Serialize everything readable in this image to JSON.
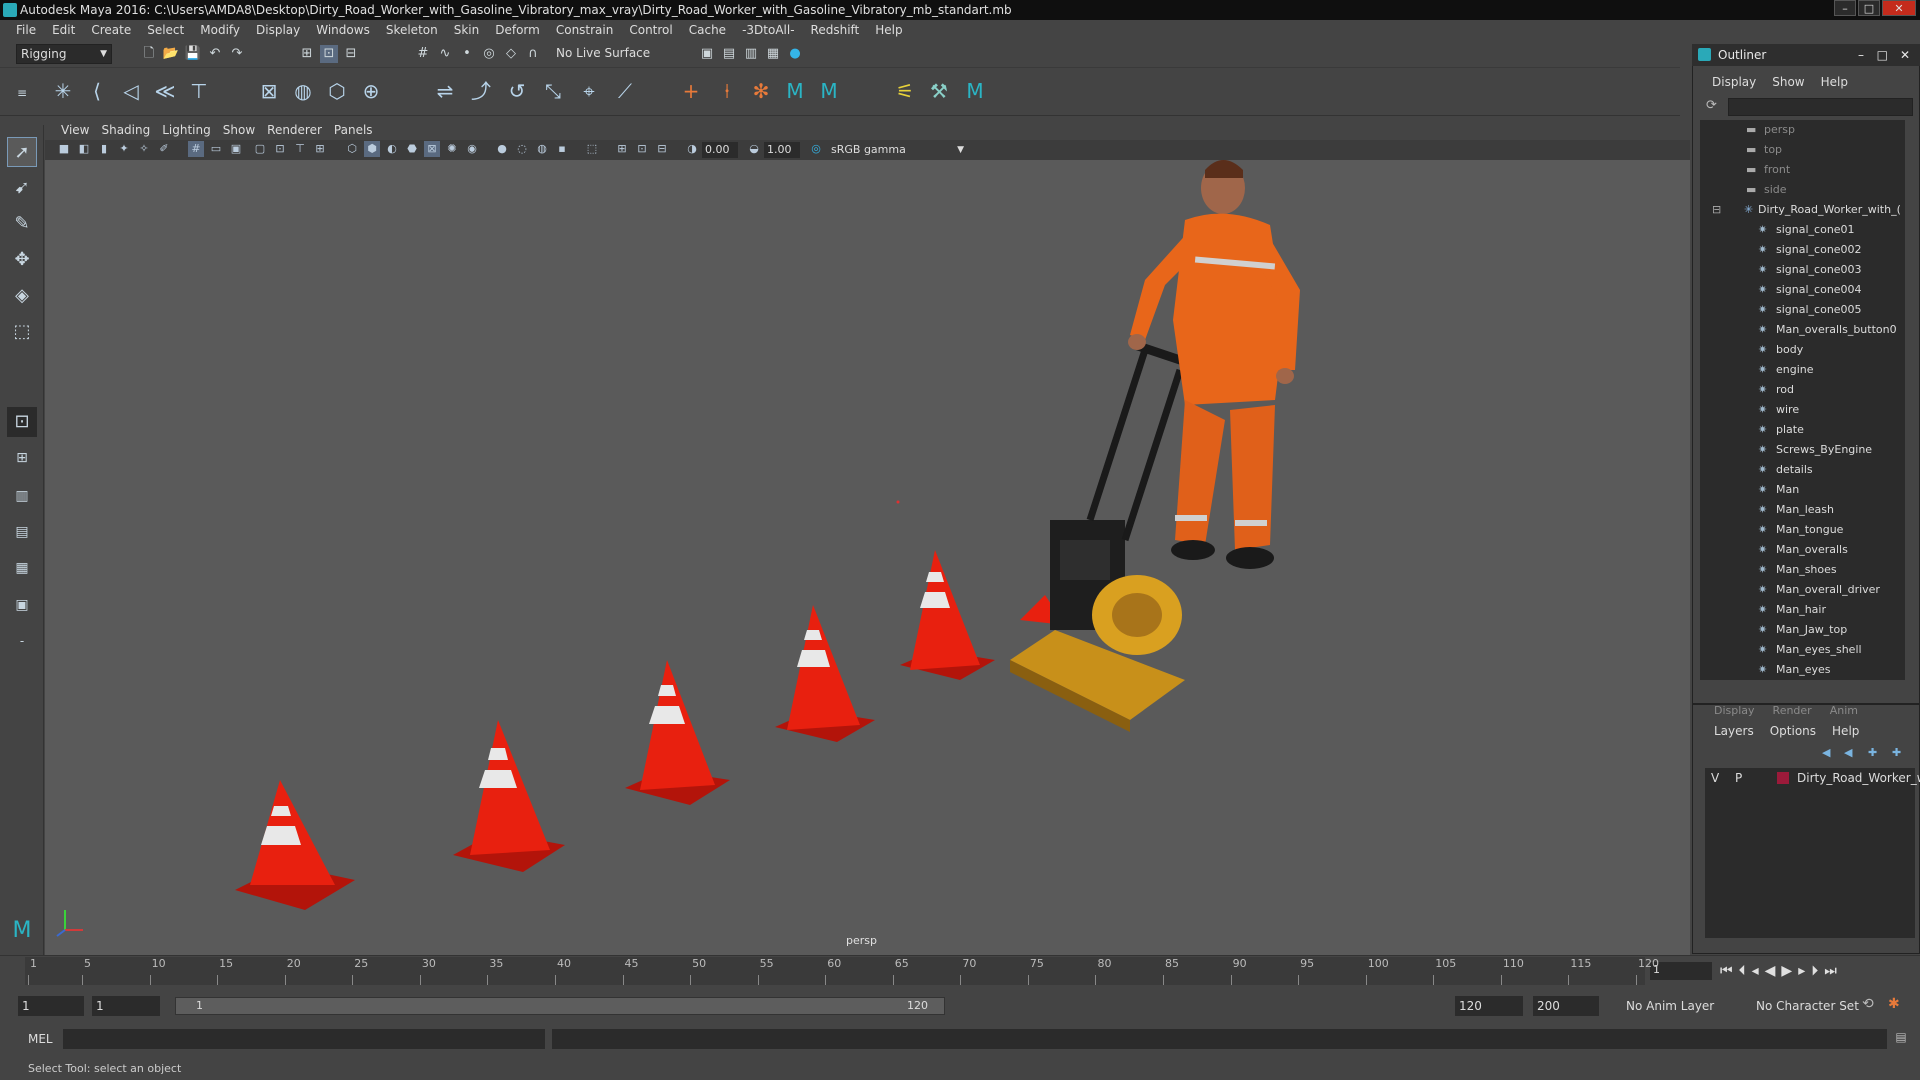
{
  "window": {
    "title": "Autodesk Maya 2016: C:\\Users\\AMDA8\\Desktop\\Dirty_Road_Worker_with_Gasoline_Vibratory_max_vray\\Dirty_Road_Worker_with_Gasoline_Vibratory_mb_standart.mb"
  },
  "menubar": [
    "File",
    "Edit",
    "Create",
    "Select",
    "Modify",
    "Display",
    "Windows",
    "Skeleton",
    "Skin",
    "Deform",
    "Constrain",
    "Control",
    "Cache",
    "-3DtoAll-",
    "Redshift",
    "Help"
  ],
  "statusline": {
    "mode": "Rigging",
    "live_surface": "No Live Surface"
  },
  "viewport": {
    "menu": [
      "View",
      "Shading",
      "Lighting",
      "Show",
      "Renderer",
      "Panels"
    ],
    "near_value": "0.00",
    "far_value": "1.00",
    "color_space": "sRGB gamma",
    "camera_label": "persp"
  },
  "outliner": {
    "title": "Outliner",
    "menu": [
      "Display",
      "Show",
      "Help"
    ],
    "cameras": [
      "persp",
      "top",
      "front",
      "side"
    ],
    "group": "Dirty_Road_Worker_with_(",
    "items": [
      "signal_cone01",
      "signal_cone002",
      "signal_cone003",
      "signal_cone004",
      "signal_cone005",
      "Man_overalls_button0",
      "body",
      "engine",
      "rod",
      "wire",
      "plate",
      "Screws_ByEngine",
      "details",
      "Man",
      "Man_leash",
      "Man_tongue",
      "Man_overalls",
      "Man_shoes",
      "Man_overall_driver",
      "Man_hair",
      "Man_Jaw_top",
      "Man_eyes_shell",
      "Man_eyes"
    ]
  },
  "layers": {
    "tabs": [
      "Display",
      "Render",
      "Anim"
    ],
    "menu": [
      "Layers",
      "Options",
      "Help"
    ],
    "row": {
      "v": "V",
      "p": "P",
      "name": "Dirty_Road_Worker_w",
      "color": "#9b1a3a"
    }
  },
  "timeline": {
    "ticks": [
      "1",
      "5",
      "10",
      "15",
      "20",
      "25",
      "30",
      "35",
      "40",
      "45",
      "50",
      "55",
      "60",
      "65",
      "70",
      "75",
      "80",
      "85",
      "90",
      "95",
      "100",
      "105",
      "110",
      "115",
      "120"
    ],
    "current_frame": "1"
  },
  "range": {
    "start": "1",
    "start2": "1",
    "slider_start": "1",
    "slider_end": "120",
    "end": "120",
    "end2": "200",
    "anim_layer": "No Anim Layer",
    "char_set": "No Character Set"
  },
  "cmdline": {
    "label": "MEL"
  },
  "helpline": {
    "text": "Select Tool: select an object"
  },
  "colors": {
    "cone_red": "#e8200f",
    "cone_stripe": "#e8e8e8",
    "overall_orange": "#e8661a",
    "plate_yellow": "#d9a020"
  }
}
